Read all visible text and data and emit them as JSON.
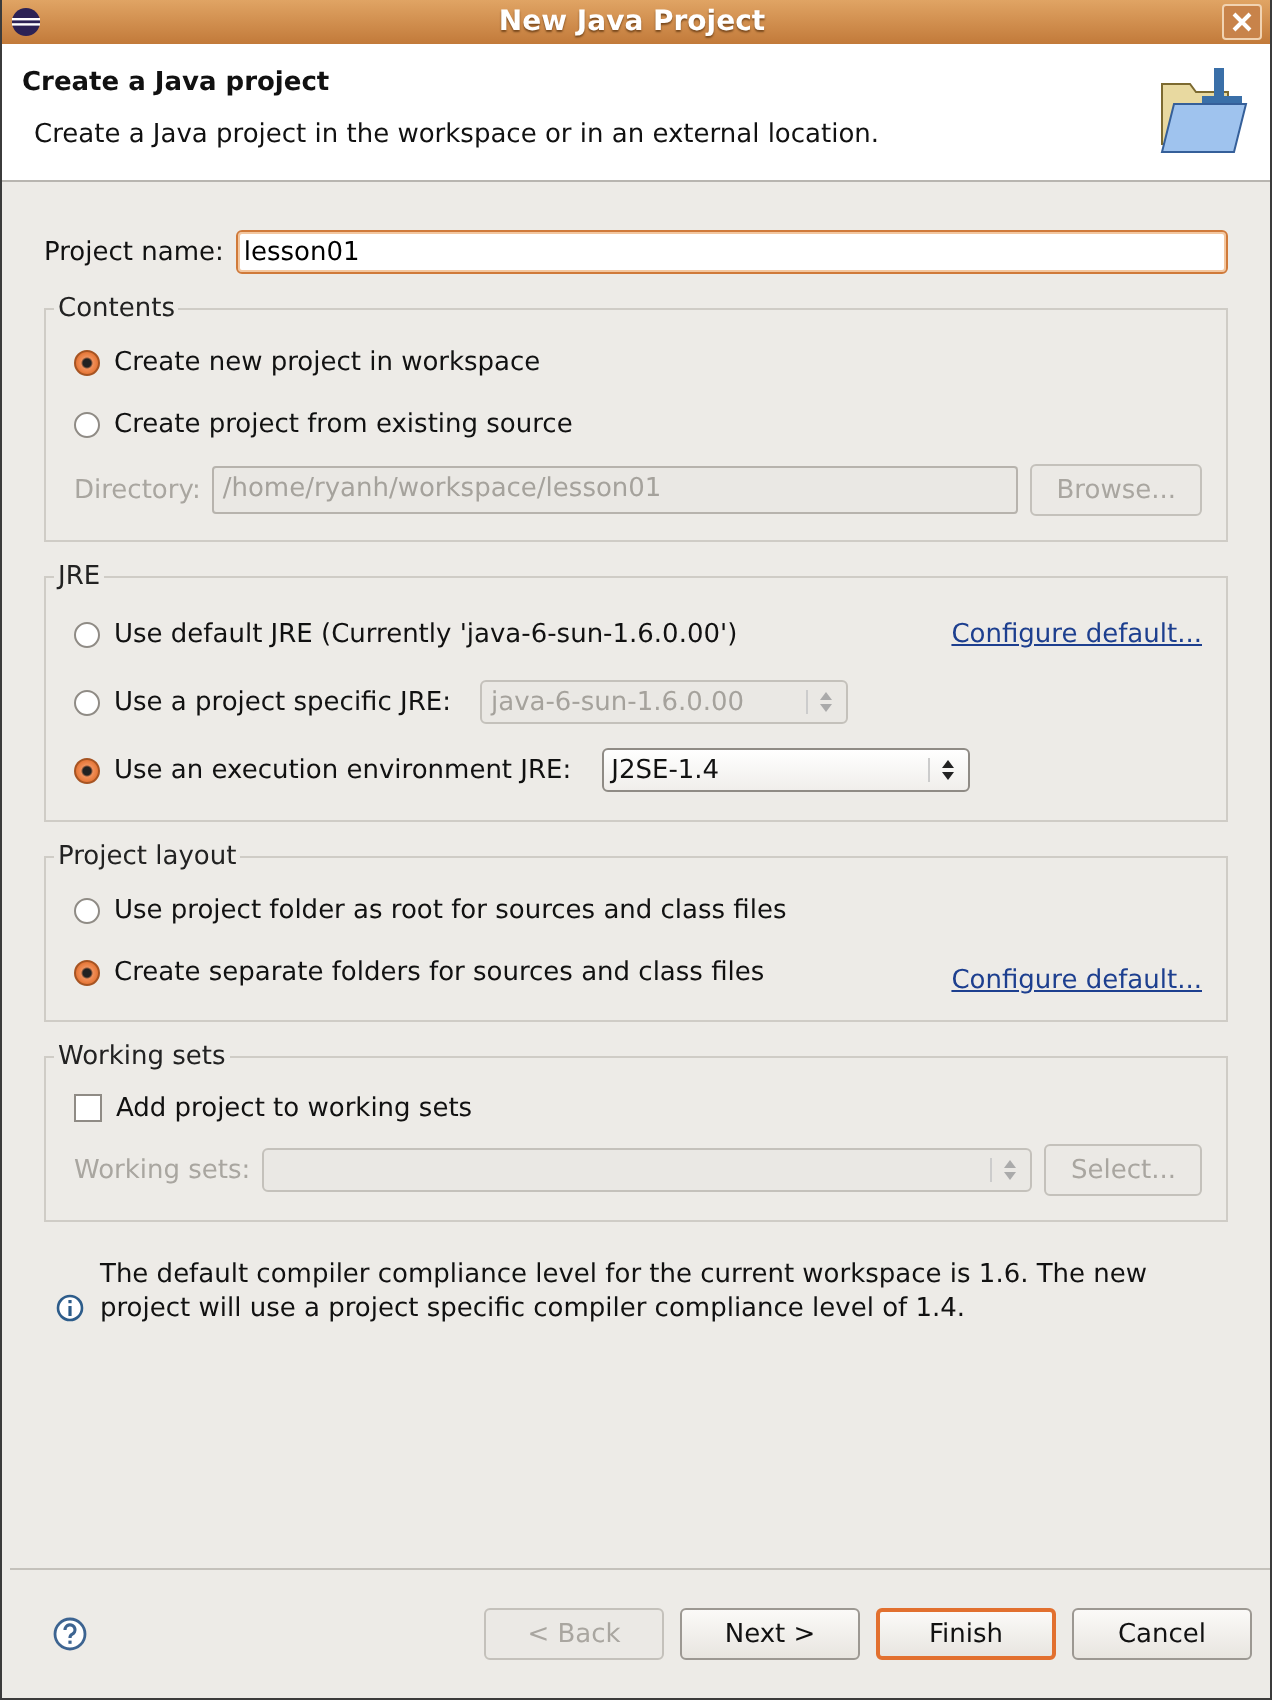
{
  "window": {
    "title": "New Java Project"
  },
  "header": {
    "title": "Create a Java project",
    "description": "Create a Java project in the workspace or in an external location."
  },
  "project_name": {
    "label": "Project name:",
    "value": "lesson01"
  },
  "contents": {
    "title": "Contents",
    "options": [
      {
        "label": "Create new project in workspace",
        "selected": true
      },
      {
        "label": "Create project from existing source",
        "selected": false
      }
    ],
    "directory": {
      "label": "Directory:",
      "value": "/home/ryanh/workspace/lesson01",
      "disabled": true
    },
    "browse": {
      "label": "Browse...",
      "disabled": true
    }
  },
  "jre": {
    "title": "JRE",
    "options": [
      {
        "kind": "link",
        "label": "Use default JRE (Currently 'java-6-sun-1.6.0.00')",
        "selected": false,
        "link": "Configure default..."
      },
      {
        "kind": "select",
        "label": "Use a project specific JRE:",
        "selected": false,
        "value": "java-6-sun-1.6.0.00",
        "disabled": true
      },
      {
        "kind": "select",
        "label": "Use an execution environment JRE:",
        "selected": true,
        "value": "J2SE-1.4",
        "disabled": false
      }
    ]
  },
  "project_layout": {
    "title": "Project layout",
    "options": [
      {
        "kind": "plain",
        "label": "Use project folder as root for sources and class files",
        "selected": false
      },
      {
        "kind": "link",
        "label": "Create separate folders for sources and class files",
        "selected": true,
        "link": "Configure default..."
      }
    ]
  },
  "working_sets": {
    "title": "Working sets",
    "checkbox": {
      "label": "Add project to working sets",
      "checked": false
    },
    "field": {
      "label": "Working sets:",
      "disabled": true
    },
    "select": {
      "label": "Select...",
      "disabled": true
    }
  },
  "info": "The default compiler compliance level for the current workspace is 1.6. The new project will use a project specific compiler compliance level of 1.4.",
  "buttons": [
    {
      "label": "< Back",
      "disabled": true,
      "default": false
    },
    {
      "label": "Next >",
      "disabled": false,
      "default": false
    },
    {
      "label": "Finish",
      "disabled": false,
      "default": true
    },
    {
      "label": "Cancel",
      "disabled": false,
      "default": false
    }
  ]
}
